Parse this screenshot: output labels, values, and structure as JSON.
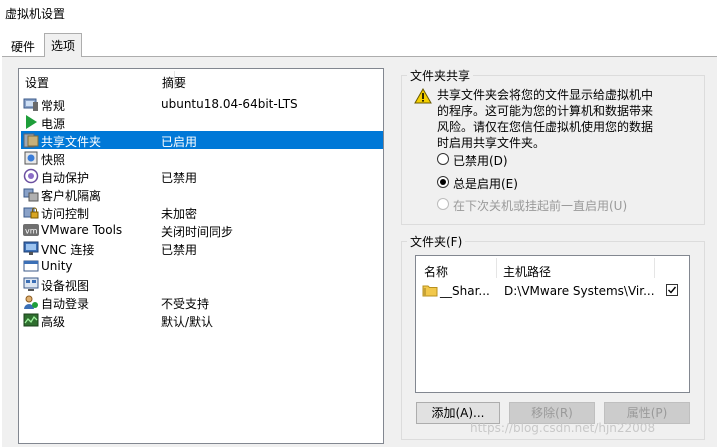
{
  "window": {
    "title": "虚拟机设置"
  },
  "tabs": [
    {
      "label": "硬件",
      "active": false
    },
    {
      "label": "选项",
      "active": true
    }
  ],
  "settings_list": {
    "header": {
      "setting": "设置",
      "summary": "摘要"
    },
    "rows": [
      {
        "name": "常规",
        "summary": "ubuntu18.04-64bit-LTS",
        "icon": "general-icon",
        "selected": false
      },
      {
        "name": "电源",
        "summary": "",
        "icon": "power-icon",
        "selected": false
      },
      {
        "name": "共享文件夹",
        "summary": "已启用",
        "icon": "shared-folder-icon",
        "selected": true
      },
      {
        "name": "快照",
        "summary": "",
        "icon": "snapshot-icon",
        "selected": false
      },
      {
        "name": "自动保护",
        "summary": "已禁用",
        "icon": "autoprotect-icon",
        "selected": false
      },
      {
        "name": "客户机隔离",
        "summary": "",
        "icon": "isolation-icon",
        "selected": false
      },
      {
        "name": "访问控制",
        "summary": "未加密",
        "icon": "access-control-icon",
        "selected": false
      },
      {
        "name": "VMware Tools",
        "summary": "关闭时间同步",
        "icon": "vmware-tools-icon",
        "selected": false
      },
      {
        "name": "VNC 连接",
        "summary": "已禁用",
        "icon": "vnc-icon",
        "selected": false
      },
      {
        "name": "Unity",
        "summary": "",
        "icon": "unity-icon",
        "selected": false
      },
      {
        "name": "设备视图",
        "summary": "",
        "icon": "device-view-icon",
        "selected": false
      },
      {
        "name": "自动登录",
        "summary": "不受支持",
        "icon": "autologin-icon",
        "selected": false
      },
      {
        "name": "高级",
        "summary": "默认/默认",
        "icon": "advanced-icon",
        "selected": false
      }
    ]
  },
  "folder_sharing": {
    "title": "文件夹共享",
    "warning": "共享文件夹会将您的文件显示给虚拟机中的程序。这可能为您的计算机和数据带来风险。请仅在您信任虚拟机使用您的数据时启用共享文件夹。",
    "options": [
      {
        "label": "已禁用(D)",
        "checked": false,
        "enabled": true
      },
      {
        "label": "总是启用(E)",
        "checked": true,
        "enabled": true
      },
      {
        "label": "在下次关机或挂起前一直启用(U)",
        "checked": false,
        "enabled": false
      }
    ]
  },
  "folders": {
    "title": "文件夹(F)",
    "columns": {
      "name": "名称",
      "host_path": "主机路径"
    },
    "rows": [
      {
        "name": "__Shar...",
        "host_path": "D:\\VMware Systems\\Vir...",
        "enabled": true
      }
    ],
    "buttons": {
      "add": "添加(A)...",
      "remove": "移除(R)",
      "properties": "属性(P)"
    }
  },
  "watermark": "https://blog.csdn.net/hjn22008"
}
